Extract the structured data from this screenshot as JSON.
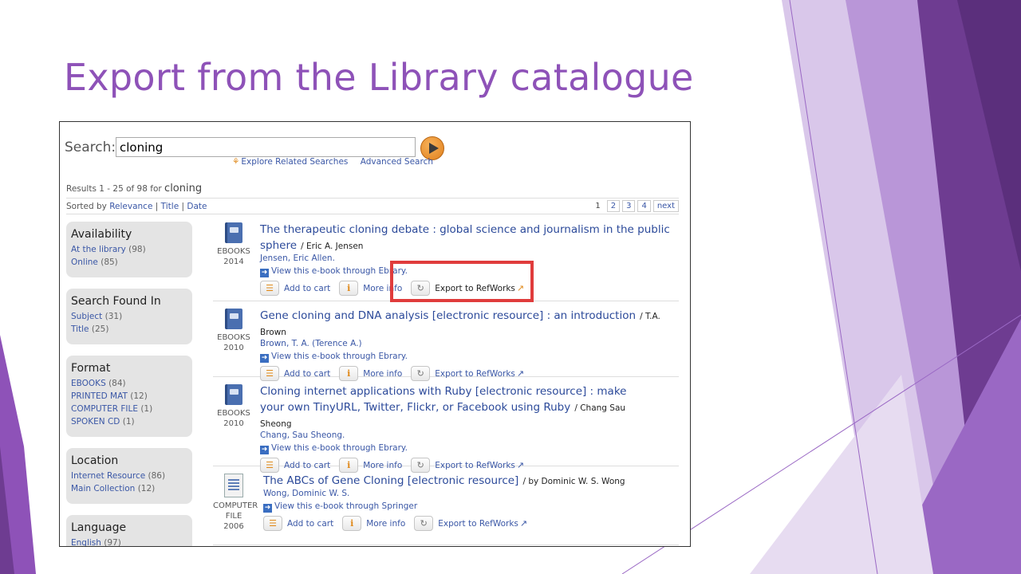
{
  "slide": {
    "title": "Export from the Library catalogue"
  },
  "search": {
    "label": "Search:",
    "query": "cloning",
    "explore_label": "Explore Related Searches",
    "advanced_label": "Advanced Search"
  },
  "results": {
    "count_prefix": "Results 1 - 25 of 98 for",
    "count_term": "cloning",
    "sorted_by": "Sorted by",
    "sort_relevance": "Relevance",
    "sort_title": "Title",
    "sort_date": "Date",
    "pages": [
      "1",
      "2",
      "3",
      "4",
      "next"
    ]
  },
  "facets": [
    {
      "title": "Availability",
      "items": [
        {
          "label": "At the library",
          "count": "(98)"
        },
        {
          "label": "Online",
          "count": "(85)"
        }
      ]
    },
    {
      "title": "Search Found In",
      "items": [
        {
          "label": "Subject",
          "count": "(31)"
        },
        {
          "label": "Title",
          "count": "(25)"
        }
      ]
    },
    {
      "title": "Format",
      "items": [
        {
          "label": "EBOOKS",
          "count": "(84)"
        },
        {
          "label": "PRINTED MAT",
          "count": "(12)"
        },
        {
          "label": "COMPUTER FILE",
          "count": "(1)"
        },
        {
          "label": "SPOKEN CD",
          "count": "(1)"
        }
      ]
    },
    {
      "title": "Location",
      "items": [
        {
          "label": "Internet Resource",
          "count": "(86)"
        },
        {
          "label": "Main Collection",
          "count": "(12)"
        }
      ]
    },
    {
      "title": "Language",
      "items": [
        {
          "label": "English",
          "count": "(97)"
        }
      ]
    }
  ],
  "actions": {
    "add_to_cart": "Add to cart",
    "more_info": "More info",
    "export": "Export to RefWorks",
    "pipe": "|"
  },
  "items": [
    {
      "format_line1": "EBOOKS",
      "format_line2": "2014",
      "title": "The therapeutic cloning debate : global science and journalism in the public sphere",
      "resp": "/ Eric A. Jensen",
      "author": "Jensen, Eric Allen.",
      "link": "View this e-book through Ebrary."
    },
    {
      "format_line1": "EBOOKS",
      "format_line2": "2010",
      "title": "Gene cloning and DNA analysis [electronic resource] : an introduction",
      "resp": "/ T.A. Brown",
      "author": "Brown, T. A. (Terence A.)",
      "link": "View this e-book through Ebrary."
    },
    {
      "format_line1": "EBOOKS",
      "format_line2": "2010",
      "title": "Cloning internet applications with Ruby [electronic resource] : make your own TinyURL, Twitter, Flickr, or Facebook using Ruby",
      "resp": "/ Chang Sau Sheong",
      "author": "Chang, Sau Sheong.",
      "link": "View this e-book through Ebrary."
    },
    {
      "format_line1": "COMPUTER",
      "format_line2": "FILE",
      "format_line3": "2006",
      "title": "The ABCs of Gene Cloning [electronic resource]",
      "resp": "/ by Dominic W. S. Wong",
      "author": "Wong, Dominic W. S.",
      "link": "View this e-book through Springer"
    }
  ],
  "colors": {
    "accent": "#8e52b8",
    "highlight": "#e03c3c",
    "link": "#3a57a6"
  }
}
